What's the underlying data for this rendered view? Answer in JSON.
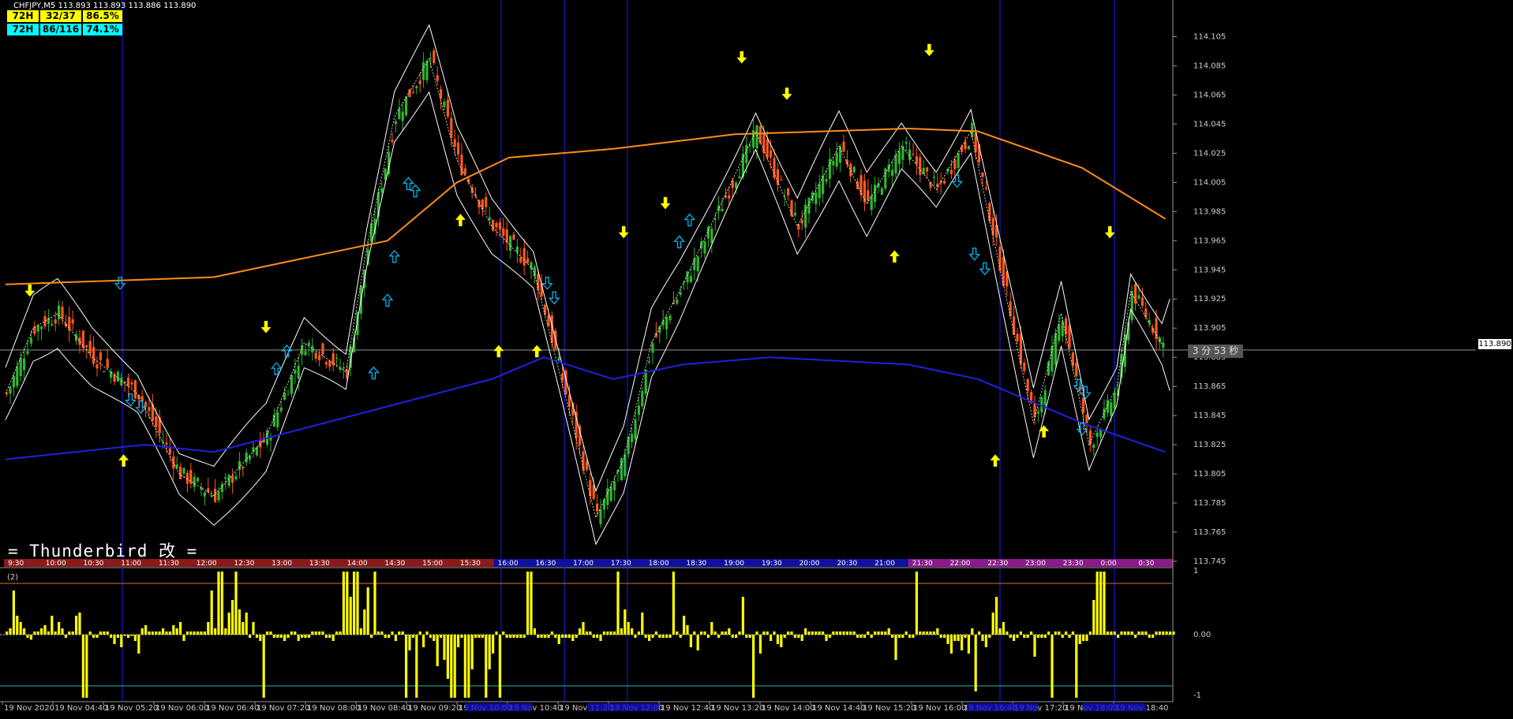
{
  "header": {
    "symbol_line": "CHFJPY,M5  113.893 113.893 113.886 113.890",
    "stats": [
      {
        "label": "72H",
        "count": "32/37",
        "pct": "86.5%"
      },
      {
        "label": "72H",
        "count": "86/116",
        "pct": "74.1%"
      }
    ]
  },
  "brand_text": "= Thunderbird 改 =",
  "timer_text": "3 分 53 秒",
  "current_price": "113.890",
  "colors": {
    "background": "#000000",
    "bull": "#2fb52f",
    "bear": "#ff5a1e",
    "ma_long": "#ff8c1a",
    "ma_mid": "#2020e0",
    "bands": "#ffffff",
    "arrow_yellow": "#ffff00",
    "arrow_cyan": "#00bfff",
    "histogram": "#ffff00"
  },
  "chart_data": [
    {
      "type": "candlestick",
      "symbol": "CHFJPY",
      "timeframe": "M5",
      "ylim": [
        113.745,
        114.115
      ],
      "y_ticks": [
        "114.105",
        "114.085",
        "114.065",
        "114.045",
        "114.025",
        "114.005",
        "113.985",
        "113.965",
        "113.945",
        "113.925",
        "113.905",
        "113.885",
        "113.865",
        "113.845",
        "113.825",
        "113.805",
        "113.785",
        "113.765",
        "113.745"
      ],
      "session_labels": [
        "9:30",
        "10:00",
        "10:30",
        "11:00",
        "11:30",
        "12:00",
        "12:30",
        "13:00",
        "13:30",
        "14:00",
        "14:30",
        "15:00",
        "15:30",
        "16:00",
        "16:30",
        "17:00",
        "17:30",
        "18:00",
        "18:30",
        "19:00",
        "19:30",
        "20:00",
        "20:30",
        "21:00",
        "21:30",
        "22:00",
        "22:30",
        "23:00",
        "23:30",
        "0:00",
        "0:30"
      ],
      "close_path": [
        [
          0,
          113.86
        ],
        [
          8,
          113.905
        ],
        [
          15,
          113.915
        ],
        [
          25,
          113.885
        ],
        [
          38,
          113.86
        ],
        [
          50,
          113.805
        ],
        [
          60,
          113.79
        ],
        [
          75,
          113.83
        ],
        [
          86,
          113.895
        ],
        [
          98,
          113.875
        ],
        [
          104,
          113.96
        ],
        [
          112,
          114.05
        ],
        [
          122,
          114.09
        ],
        [
          130,
          114.02
        ],
        [
          140,
          113.975
        ],
        [
          152,
          113.945
        ],
        [
          160,
          113.87
        ],
        [
          170,
          113.775
        ],
        [
          178,
          113.815
        ],
        [
          186,
          113.895
        ],
        [
          194,
          113.93
        ],
        [
          206,
          113.99
        ],
        [
          216,
          114.04
        ],
        [
          228,
          113.975
        ],
        [
          240,
          114.03
        ],
        [
          248,
          113.99
        ],
        [
          258,
          114.03
        ],
        [
          268,
          114.0
        ],
        [
          278,
          114.04
        ],
        [
          286,
          113.95
        ],
        [
          296,
          113.84
        ],
        [
          304,
          113.915
        ],
        [
          312,
          113.825
        ],
        [
          320,
          113.865
        ],
        [
          324,
          113.93
        ],
        [
          334,
          113.89
        ]
      ],
      "ma_long": [
        [
          0,
          113.935
        ],
        [
          60,
          113.94
        ],
        [
          110,
          113.965
        ],
        [
          130,
          114.005
        ],
        [
          145,
          114.022
        ],
        [
          175,
          114.028
        ],
        [
          210,
          114.038
        ],
        [
          260,
          114.042
        ],
        [
          280,
          114.04
        ],
        [
          310,
          114.015
        ],
        [
          334,
          113.98
        ]
      ],
      "ma_mid": [
        [
          0,
          113.815
        ],
        [
          40,
          113.825
        ],
        [
          60,
          113.82
        ],
        [
          100,
          113.845
        ],
        [
          140,
          113.87
        ],
        [
          155,
          113.885
        ],
        [
          175,
          113.87
        ],
        [
          195,
          113.88
        ],
        [
          220,
          113.885
        ],
        [
          260,
          113.88
        ],
        [
          280,
          113.87
        ],
        [
          310,
          113.84
        ],
        [
          334,
          113.82
        ]
      ],
      "arrows_down_yellow": [
        [
          7,
          113.93
        ],
        [
          75,
          113.905
        ],
        [
          178,
          113.97
        ],
        [
          190,
          113.99
        ],
        [
          212,
          114.09
        ],
        [
          225,
          114.065
        ],
        [
          266,
          114.095
        ],
        [
          318,
          113.97
        ]
      ],
      "arrows_up_yellow": [
        [
          34,
          113.815
        ],
        [
          131,
          113.98
        ],
        [
          142,
          113.89
        ],
        [
          153,
          113.89
        ],
        [
          256,
          113.955
        ],
        [
          285,
          113.815
        ],
        [
          299,
          113.835
        ]
      ],
      "arrows_down_cyan": [
        [
          33,
          113.935
        ],
        [
          36,
          113.855
        ],
        [
          39,
          113.85
        ],
        [
          156,
          113.935
        ],
        [
          158,
          113.925
        ],
        [
          274,
          114.005
        ],
        [
          279,
          113.955
        ],
        [
          282,
          113.945
        ],
        [
          309,
          113.865
        ],
        [
          311,
          113.86
        ],
        [
          310,
          113.835
        ]
      ],
      "arrows_up_cyan": [
        [
          78,
          113.878
        ],
        [
          81,
          113.89
        ],
        [
          110,
          113.925
        ],
        [
          112,
          113.955
        ],
        [
          116,
          114.005
        ],
        [
          118,
          114.0
        ],
        [
          106,
          113.875
        ],
        [
          194,
          113.965
        ],
        [
          197,
          113.98
        ]
      ]
    },
    {
      "type": "bar",
      "name": "(2)",
      "ylim": [
        -1,
        1
      ],
      "y_ticks": [
        "1",
        "0.00",
        "-1"
      ],
      "x_labels": [
        "19 Nov 2020",
        "19 Nov 04:40",
        "19 Nov 05:20",
        "19 Nov 06:00",
        "19 Nov 06:40",
        "19 Nov 07:20",
        "19 Nov 08:00",
        "19 Nov 08:40",
        "19 Nov 09:20",
        "19 Nov 10:00",
        "19 Nov 10:40",
        "19 Nov 11:20",
        "19 Nov 12:00",
        "19 Nov 12:40",
        "19 Nov 13:20",
        "19 Nov 14:00",
        "19 Nov 14:40",
        "19 Nov 15:20",
        "19 Nov 16:00",
        "19 Nov 16:40",
        "19 Nov 17:20",
        "19 Nov 18:00",
        "19 Nov 18:40"
      ],
      "values": [
        0.05,
        0.1,
        0.7,
        0.3,
        0.2,
        0.1,
        -0.05,
        -0.08,
        0.05,
        0.05,
        0.1,
        0.15,
        0.05,
        0.3,
        0.05,
        0.2,
        0.1,
        -0.05,
        0.05,
        0.05,
        0.3,
        0.35,
        -1,
        -1,
        0.05,
        -0.05,
        -0.05,
        0.05,
        0.05,
        0.05,
        -0.05,
        -0.15,
        -0.05,
        -0.2,
        -0.02,
        -0.05,
        -0.02,
        -0.1,
        -0.3,
        0.1,
        0.15,
        0.05,
        0.05,
        0.05,
        0.05,
        0.1,
        0.05,
        0.05,
        0.15,
        0.1,
        0.2,
        -0.1,
        0.05,
        0.05,
        0.05,
        0.05,
        0.05,
        0.05,
        0.2,
        0.7,
        0.1,
        1,
        1,
        0.1,
        0.35,
        0.55,
        1,
        0.4,
        0.2,
        0.35,
        -0.05,
        0.2,
        -0.05,
        -0.1,
        -1,
        0.05,
        0.05,
        -0.05,
        -0.05,
        -0.05,
        -0.1,
        -0.05,
        0.05,
        0.05,
        -0.1,
        -0.05,
        -0.05,
        -0.05,
        0.05,
        0.05,
        0.05,
        0.05,
        -0.05,
        -0.05,
        -0.1,
        0.05,
        0.05,
        1,
        1,
        0.6,
        1,
        1,
        0.1,
        0.4,
        0.75,
        -0.05,
        1,
        0.05,
        0.05,
        -0.05,
        -0.05,
        0.05,
        -0.1,
        0.05,
        0.05,
        -1,
        -0.25,
        -0.05,
        -1,
        0.05,
        -0.2,
        0.05,
        -0.05,
        -0.1,
        -0.5,
        -0.05,
        -0.4,
        -0.7,
        -1,
        -1,
        -0.2,
        -0.05,
        -1,
        -1,
        -0.55,
        -0.05,
        -0.05,
        -0.05,
        -1,
        -0.55,
        -0.3,
        0.05,
        -1,
        0.05,
        -0.05,
        -0.05,
        -0.05,
        -0.05,
        -0.05,
        -0.05,
        1,
        1,
        0.1,
        -0.05,
        -0.05,
        -0.05,
        -0.05,
        0.05,
        -0.05,
        -0.15,
        -0.05,
        -0.05,
        -0.05,
        -0.1,
        -0.05,
        0.1,
        0.2,
        0.05,
        0.05,
        -0.05,
        -0.05,
        -0.1,
        0.05,
        0.05,
        0.05,
        0.05,
        1,
        0.1,
        0.4,
        0.2,
        0.1,
        -0.05,
        0.05,
        0.35,
        -0.05,
        -0.1,
        -0.05,
        0.05,
        -0.05,
        -0.05,
        -0.05,
        -0.05,
        1,
        0.05,
        -0.05,
        0.3,
        0.15,
        -0.2,
        0.05,
        -0.25,
        0.05,
        0.05,
        -0.05,
        0.2,
        0.05,
        -0.05,
        0.05,
        0.05,
        0.1,
        -0.05,
        -0.05,
        0.05,
        0.6,
        -0.05,
        -0.05,
        -1,
        0.05,
        -0.3,
        0.05,
        0.05,
        -0.1,
        0.05,
        -0.15,
        -0.2,
        -0.05,
        0.05,
        0.05,
        -0.05,
        -0.05,
        -0.1,
        0.1,
        0.05,
        0.05,
        0.05,
        0.05,
        0.05,
        -0.1,
        -0.05,
        0.05,
        0.05,
        0.05,
        0.05,
        0.05,
        0.05,
        0.05,
        -0.05,
        -0.05,
        -0.05,
        0.05,
        -0.05,
        0.05,
        0.05,
        0.05,
        0.05,
        0.1,
        -0.05,
        -0.4,
        -0.05,
        -0.05,
        0.05,
        -0.05,
        -0.05,
        1,
        0.05,
        0.05,
        0.05,
        0.05,
        0.05,
        0.1,
        -0.05,
        -0.05,
        -0.15,
        -0.3,
        -0.1,
        -0.1,
        -0.25,
        -0.05,
        -0.3,
        0.1,
        -0.9,
        0.05,
        -0.1,
        -0.2,
        -0.05,
        0.35,
        0.6,
        0.1,
        0.2,
        0.05,
        -0.05,
        -0.1,
        -0.05,
        0.05,
        -0.05,
        -0.05,
        0.05,
        -0.35,
        -0.05,
        -0.05,
        -0.05,
        0.05,
        -1,
        0.05,
        0.05,
        -0.05,
        0.05,
        -0.05,
        0.05,
        -1,
        -0.15,
        -0.1,
        -0.1,
        0.05,
        0.55,
        1,
        1,
        1,
        0.05,
        0.05,
        0.05,
        -0.05,
        0.05,
        0.05,
        0.05,
        0.05,
        -0.05,
        0.05,
        0.05,
        0.05,
        -0.05,
        -0.05,
        0.05,
        0.05,
        0.05,
        0.05,
        0.05,
        0.05
      ]
    }
  ]
}
